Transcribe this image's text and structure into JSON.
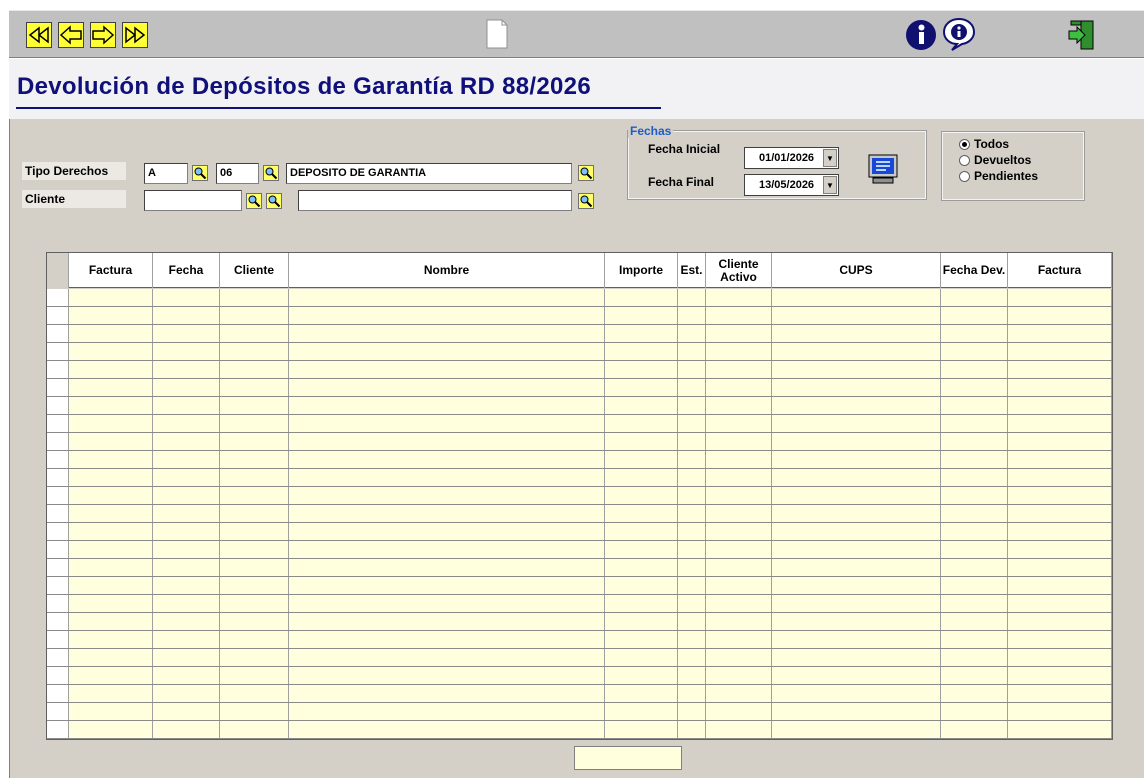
{
  "toolbar": {
    "first": "first-record-icon",
    "prev": "previous-record-icon",
    "next": "next-record-icon",
    "last": "last-record-icon",
    "doc": "document-icon",
    "info": "info-icon",
    "help": "help-icon",
    "exit": "exit-icon"
  },
  "title": "Devolución de Depósitos de Garantía RD 88/2026",
  "filters": {
    "tipo_label": "Tipo Derechos",
    "tipo_code": "A",
    "tipo_num": "06",
    "tipo_desc": "DEPOSITO DE GARANTIA",
    "cliente_label": "Cliente",
    "cliente_code": "",
    "cliente_desc": ""
  },
  "fechas": {
    "legend": "Fechas",
    "inicial_label": "Fecha Inicial",
    "inicial_value": "01/01/2026",
    "final_label": "Fecha Final",
    "final_value": "13/05/2026"
  },
  "estado": {
    "options": [
      "Todos",
      "Devueltos",
      "Pendientes"
    ],
    "selected": "Todos"
  },
  "grid": {
    "columns": [
      "Factura",
      "Fecha",
      "Cliente",
      "Nombre",
      "Importe",
      "Est.",
      "Cliente Activo",
      "CUPS",
      "Fecha Dev.",
      "Factura"
    ],
    "rows": []
  },
  "status": ""
}
